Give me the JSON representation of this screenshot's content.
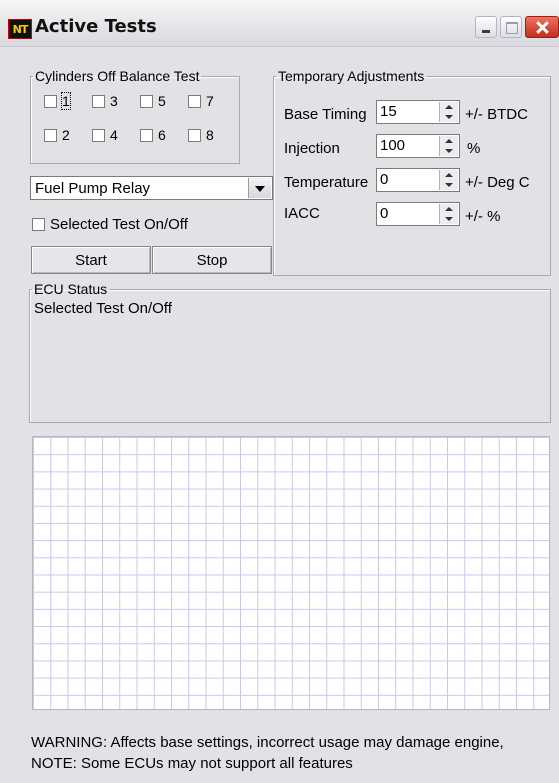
{
  "window": {
    "title": "Active Tests",
    "logo_text": "NT",
    "buttons": [
      "minimize-icon",
      "maximize-icon",
      "close-icon"
    ]
  },
  "cylinders": {
    "legend": "Cylinders Off Balance Test",
    "items": [
      {
        "label": "1",
        "checked": false
      },
      {
        "label": "3",
        "checked": false
      },
      {
        "label": "5",
        "checked": false
      },
      {
        "label": "7",
        "checked": false
      },
      {
        "label": "2",
        "checked": false
      },
      {
        "label": "4",
        "checked": false
      },
      {
        "label": "6",
        "checked": false
      },
      {
        "label": "8",
        "checked": false
      }
    ]
  },
  "test_select": {
    "selected": "Fuel Pump Relay"
  },
  "toggle": {
    "label": "Selected Test On/Off",
    "checked": false
  },
  "actions": {
    "start_label": "Start",
    "stop_label": "Stop"
  },
  "adjustments": {
    "legend": "Temporary Adjustments",
    "rows": [
      {
        "label": "Base Timing",
        "value": "15",
        "unit": "+/- BTDC"
      },
      {
        "label": "Injection",
        "value": "100",
        "unit": "%"
      },
      {
        "label": "Temperature",
        "value": "0",
        "unit": "+/- Deg C"
      },
      {
        "label": "IACC",
        "value": "0",
        "unit": "+/- %"
      }
    ]
  },
  "ecu_status": {
    "legend": "ECU Status",
    "text": "Selected Test On/Off"
  },
  "footer": {
    "warning": "WARNING: Affects base settings, incorrect usage may damage engine,",
    "note": "NOTE: Some ECUs may not support all features"
  },
  "colors": {
    "window_bg": "#e2e2e6",
    "grid_line": "#c9c8ee",
    "close_button": "#d04030"
  }
}
